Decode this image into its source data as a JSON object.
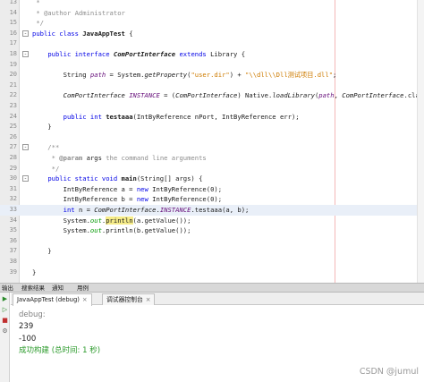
{
  "editor": {
    "highlighted_line": "33",
    "lines": [
      {
        "n": "13",
        "tokens": [
          {
            "t": " *",
            "c": "cm"
          }
        ]
      },
      {
        "n": "14",
        "tokens": [
          {
            "t": " * @author Administrator",
            "c": "cm"
          }
        ]
      },
      {
        "n": "15",
        "tokens": [
          {
            "t": " */",
            "c": "cm"
          }
        ]
      },
      {
        "n": "16",
        "tokens": [
          {
            "t": "public class ",
            "c": "kw"
          },
          {
            "t": "JavaAppTest",
            "c": "bd"
          },
          {
            "t": " {"
          }
        ],
        "fold": "-"
      },
      {
        "n": "17",
        "tokens": []
      },
      {
        "n": "18",
        "tokens": [
          {
            "t": "    "
          },
          {
            "t": "public interface ",
            "c": "kw"
          },
          {
            "t": "ComPortInterface",
            "c": "bd it"
          },
          {
            "t": " "
          },
          {
            "t": "extends",
            "c": "kw"
          },
          {
            "t": " Library {"
          }
        ],
        "fold": "-"
      },
      {
        "n": "19",
        "tokens": []
      },
      {
        "n": "20",
        "tokens": [
          {
            "t": "        String "
          },
          {
            "t": "path",
            "c": "cn"
          },
          {
            "t": " = System."
          },
          {
            "t": "getProperty",
            "c": "it"
          },
          {
            "t": "("
          },
          {
            "t": "\"user.dir\"",
            "c": "st"
          },
          {
            "t": ") + "
          },
          {
            "t": "\"\\\\dll\\\\Dll测试项目.dll\"",
            "c": "st"
          },
          {
            "t": ";"
          }
        ]
      },
      {
        "n": "21",
        "tokens": []
      },
      {
        "n": "22",
        "tokens": [
          {
            "t": "        "
          },
          {
            "t": "ComPortInterface",
            "c": "it"
          },
          {
            "t": " "
          },
          {
            "t": "INSTANCE",
            "c": "cn"
          },
          {
            "t": " = ("
          },
          {
            "t": "ComPortInterface",
            "c": "it"
          },
          {
            "t": ") Native."
          },
          {
            "t": "loadLibrary",
            "c": "it"
          },
          {
            "t": "("
          },
          {
            "t": "path",
            "c": "cn"
          },
          {
            "t": ", "
          },
          {
            "t": "ComPortInterface",
            "c": "it"
          },
          {
            "t": ".class);"
          }
        ]
      },
      {
        "n": "23",
        "tokens": []
      },
      {
        "n": "24",
        "tokens": [
          {
            "t": "        "
          },
          {
            "t": "public int ",
            "c": "kw"
          },
          {
            "t": "testaaa",
            "c": "bd"
          },
          {
            "t": "(IntByReference nPort, IntByReference err);"
          }
        ]
      },
      {
        "n": "25",
        "tokens": [
          {
            "t": "    }"
          }
        ]
      },
      {
        "n": "26",
        "tokens": []
      },
      {
        "n": "27",
        "tokens": [
          {
            "t": "    /**",
            "c": "cm"
          }
        ],
        "fold": "-"
      },
      {
        "n": "28",
        "tokens": [
          {
            "t": "     * ",
            "c": "cm"
          },
          {
            "t": "@param",
            "c": "cm bd"
          },
          {
            "t": " args",
            "c": ""
          },
          {
            "t": " the command line arguments",
            "c": "cm"
          }
        ]
      },
      {
        "n": "29",
        "tokens": [
          {
            "t": "     */",
            "c": "cm"
          }
        ]
      },
      {
        "n": "30",
        "tokens": [
          {
            "t": "    "
          },
          {
            "t": "public static void ",
            "c": "kw"
          },
          {
            "t": "main",
            "c": "bd"
          },
          {
            "t": "(String[] args) {"
          }
        ],
        "fold": "-"
      },
      {
        "n": "31",
        "tokens": [
          {
            "t": "        IntByReference a = "
          },
          {
            "t": "new ",
            "c": "kw"
          },
          {
            "t": "IntByReference(0);"
          }
        ]
      },
      {
        "n": "32",
        "tokens": [
          {
            "t": "        IntByReference b = "
          },
          {
            "t": "new ",
            "c": "kw"
          },
          {
            "t": "IntByReference(0);"
          }
        ]
      },
      {
        "n": "33",
        "tokens": [
          {
            "t": "        "
          },
          {
            "t": "int ",
            "c": "kw"
          },
          {
            "t": "n = "
          },
          {
            "t": "ComPortInterface",
            "c": "it"
          },
          {
            "t": "."
          },
          {
            "t": "INSTANCE",
            "c": "cn"
          },
          {
            "t": ".testaaa(a, b);"
          }
        ]
      },
      {
        "n": "34",
        "tokens": [
          {
            "t": "        System."
          },
          {
            "t": "out",
            "c": "fd it"
          },
          {
            "t": "."
          },
          {
            "t": "println",
            "c": "mk"
          },
          {
            "t": "(a.getValue());"
          }
        ]
      },
      {
        "n": "35",
        "tokens": [
          {
            "t": "        System."
          },
          {
            "t": "out",
            "c": "fd it"
          },
          {
            "t": ".println(b.getValue());"
          }
        ]
      },
      {
        "n": "36",
        "tokens": []
      },
      {
        "n": "37",
        "tokens": [
          {
            "t": "    }"
          }
        ]
      },
      {
        "n": "38",
        "tokens": []
      },
      {
        "n": "39",
        "tokens": [
          {
            "t": "}"
          }
        ]
      }
    ]
  },
  "bottom_tabs": [
    {
      "label": "输出"
    },
    {
      "label": "搜索结果"
    },
    {
      "label": "通知"
    },
    {
      "label": "用例"
    }
  ],
  "output": {
    "tabs": [
      {
        "label": "JavaAppTest (debug)",
        "close": "×",
        "active": true
      },
      {
        "label": "调试器控制台",
        "close": "×",
        "active": false
      }
    ],
    "lines": [
      {
        "text": "debug:",
        "color": "#808080"
      },
      {
        "text": "239",
        "color": "#202020"
      },
      {
        "text": "-100",
        "color": "#202020"
      },
      {
        "text": "成功构建 (总时间: 1 秒)",
        "color": "#2a9a2a"
      }
    ]
  },
  "watermark": "CSDN @jumul"
}
